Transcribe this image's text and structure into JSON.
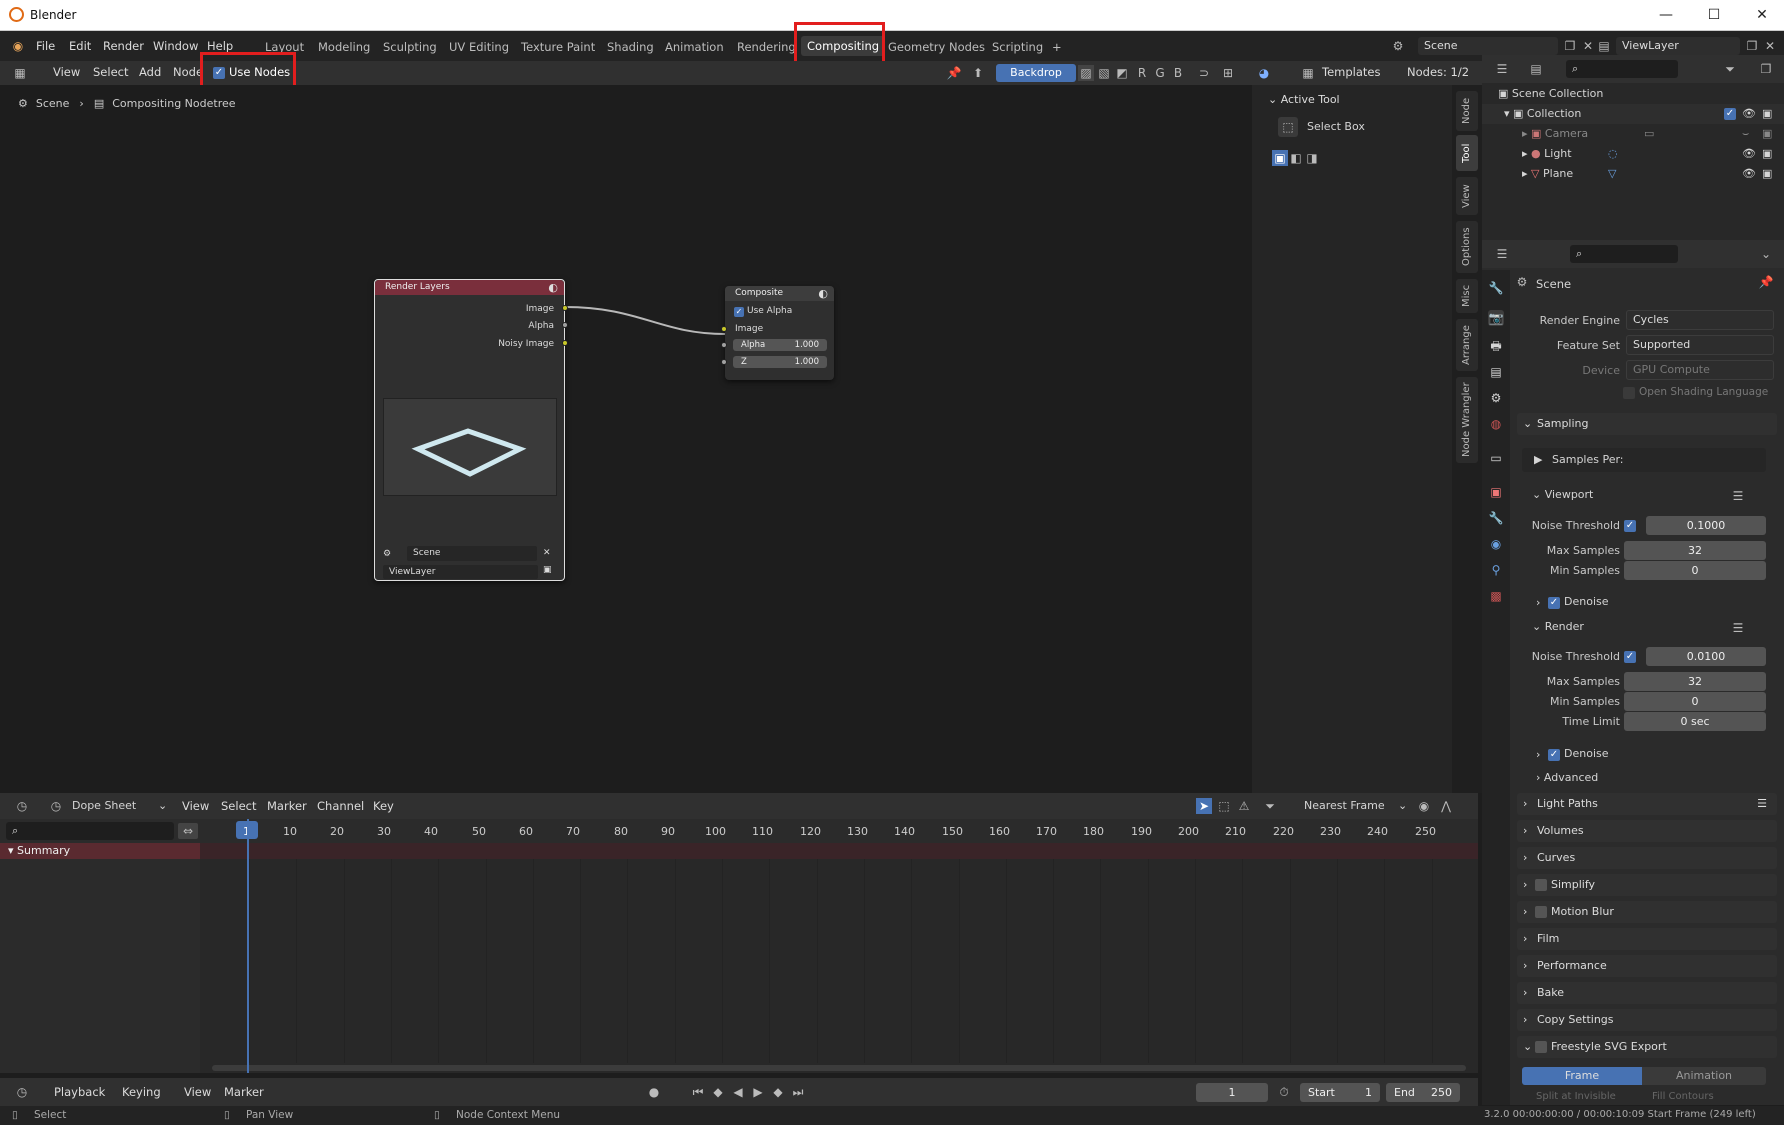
{
  "window": {
    "title": "Blender"
  },
  "menu": [
    "File",
    "Edit",
    "Render",
    "Window",
    "Help"
  ],
  "workspaces": [
    "Layout",
    "Modeling",
    "Sculpting",
    "UV Editing",
    "Texture Paint",
    "Shading",
    "Animation",
    "Rendering",
    "Compositing",
    "Geometry Nodes",
    "Scripting",
    "+"
  ],
  "topright": {
    "scene": "Scene",
    "viewlayer": "ViewLayer"
  },
  "editor_header": {
    "menus": [
      "View",
      "Select",
      "Add",
      "Node"
    ],
    "use_nodes": "Use Nodes",
    "backdrop": "Backdrop",
    "channels": [
      "R",
      "G",
      "B"
    ],
    "templates": "Templates",
    "nodes_count": "Nodes: 1/2"
  },
  "breadcrumb": {
    "scene": "Scene",
    "tree": "Compositing Nodetree"
  },
  "nodes": {
    "render_layers": {
      "title": "Render Layers",
      "outputs": [
        "Image",
        "Alpha",
        "Noisy Image"
      ],
      "scene": "Scene",
      "layer": "ViewLayer"
    },
    "composite": {
      "title": "Composite",
      "use_alpha": "Use Alpha",
      "image": "Image",
      "alpha_label": "Alpha",
      "alpha_val": "1.000",
      "z_label": "Z",
      "z_val": "1.000"
    }
  },
  "tool_panel": {
    "header": "Active Tool",
    "tool": "Select Box"
  },
  "sidebar_tabs": [
    "Node",
    "Tool",
    "View",
    "Options",
    "Misc",
    "Arrange",
    "Node Wrangler"
  ],
  "outliner": {
    "root": "Scene Collection",
    "collection": "Collection",
    "items": [
      "Camera",
      "Light",
      "Plane"
    ]
  },
  "properties": {
    "context": "Scene",
    "render_engine_label": "Render Engine",
    "render_engine": "Cycles",
    "feature_set_label": "Feature Set",
    "feature_set": "Supported",
    "device_label": "Device",
    "device": "GPU Compute",
    "osl": "Open Shading Language",
    "sampling": "Sampling",
    "samples_per": "Samples Per:",
    "viewport": "Viewport",
    "noise_threshold": "Noise Threshold",
    "vp_noise": "0.1000",
    "max_samples": "Max Samples",
    "vp_max": "32",
    "min_samples": "Min Samples",
    "vp_min": "0",
    "denoise": "Denoise",
    "render": "Render",
    "r_noise": "0.0100",
    "r_max": "32",
    "r_min": "0",
    "time_limit": "Time Limit",
    "r_time": "0 sec",
    "advanced": "Advanced",
    "sections": [
      "Light Paths",
      "Volumes",
      "Curves",
      "Simplify",
      "Motion Blur",
      "Film",
      "Performance",
      "Bake",
      "Copy Settings",
      "Freestyle SVG Export"
    ],
    "frame": "Frame",
    "animation": "Animation",
    "split_invisible": "Split at Invisible",
    "fill_contours": "Fill Contours"
  },
  "dope": {
    "mode": "Dope Sheet",
    "menus": [
      "View",
      "Select",
      "Marker",
      "Channel",
      "Key"
    ],
    "snap": "Nearest Frame",
    "summary": "Summary",
    "frames": [
      "1",
      "10",
      "20",
      "30",
      "40",
      "50",
      "60",
      "70",
      "80",
      "90",
      "100",
      "110",
      "120",
      "130",
      "140",
      "150",
      "160",
      "170",
      "180",
      "190",
      "200",
      "210",
      "220",
      "230",
      "240",
      "250"
    ]
  },
  "timeline": {
    "menus": [
      "Playback",
      "Keying",
      "View",
      "Marker"
    ],
    "current": "1",
    "start_label": "Start",
    "start": "1",
    "end_label": "End",
    "end": "250"
  },
  "status": {
    "select": "Select",
    "pan": "Pan View",
    "ctx": "Node Context Menu",
    "info": "3.2.0  00:00:00:00 / 00:00:10:09  Start Frame (249 left)"
  }
}
